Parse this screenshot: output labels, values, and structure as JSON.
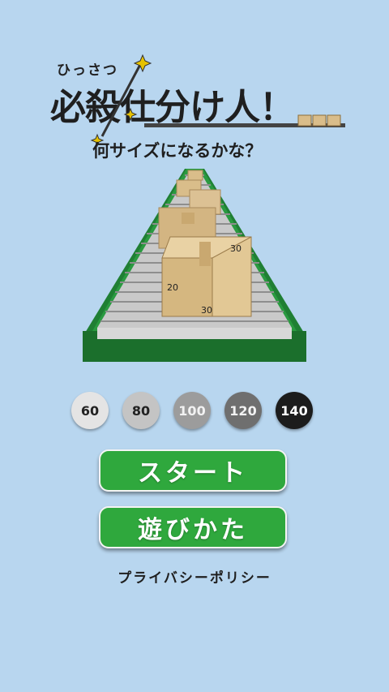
{
  "logo": {
    "ruby": "ひっさつ",
    "title": "必殺仕分け人！",
    "subtitle": "何サイズになるかな？"
  },
  "belt": {
    "box_labels": [
      "30",
      "20",
      "30"
    ]
  },
  "sizes": [
    {
      "label": "60",
      "bg": "#e4e4e4",
      "fg": "#222222"
    },
    {
      "label": "80",
      "bg": "#c4c4c4",
      "fg": "#222222"
    },
    {
      "label": "100",
      "bg": "#9c9c9c",
      "fg": "#f2f2f2"
    },
    {
      "label": "120",
      "bg": "#6f6f6f",
      "fg": "#f2f2f2"
    },
    {
      "label": "140",
      "bg": "#1c1c1c",
      "fg": "#ffffff"
    }
  ],
  "buttons": {
    "start": "スタート",
    "howto": "遊びかた"
  },
  "footer": {
    "privacy": "プライバシーポリシー"
  },
  "colors": {
    "background": "#b8d6ef",
    "button_green": "#2fa83d",
    "belt_green": "#1f7f33",
    "box_tan": "#d9bd8a"
  }
}
